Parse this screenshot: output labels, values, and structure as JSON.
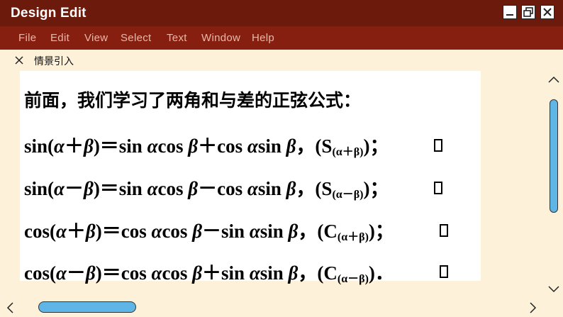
{
  "window": {
    "title": "Design Edit"
  },
  "menu": [
    {
      "label": "File"
    },
    {
      "label": "Edit"
    },
    {
      "label": "View"
    },
    {
      "label": "Select"
    },
    {
      "label": "Text"
    },
    {
      "label": "Window"
    },
    {
      "label": "Help"
    }
  ],
  "tab": {
    "label": "情景引入"
  },
  "content": {
    "heading": "前面，我们学习了两角和与差的正弦公式：",
    "formulas": [
      {
        "p1": "sin(",
        "p2": "α",
        "p3": "＋",
        "p4": "β",
        "p5": ")＝sin ",
        "p6": "α",
        "p7": "cos ",
        "p8": "β",
        "p9": "＋cos ",
        "p10": "α",
        "p11": "sin ",
        "p12": "β",
        "p13": "，(S",
        "sub": "(α＋β)",
        "p14": ")；"
      },
      {
        "p1": "sin(",
        "p2": "α",
        "p3": "－",
        "p4": "β",
        "p5": ")＝sin ",
        "p6": "α",
        "p7": "cos ",
        "p8": "β",
        "p9": "－cos ",
        "p10": "α",
        "p11": "sin ",
        "p12": "β",
        "p13": "，(S",
        "sub": "(α－β)",
        "p14": ")；"
      },
      {
        "p1": "cos(",
        "p2": "α",
        "p3": "＋",
        "p4": "β",
        "p5": ")＝cos ",
        "p6": "α",
        "p7": "cos ",
        "p8": "β",
        "p9": "－sin ",
        "p10": "α",
        "p11": "sin ",
        "p12": "β",
        "p13": "，(C",
        "sub": "(α＋β)",
        "p14": ")；"
      },
      {
        "p1": "cos(",
        "p2": "α",
        "p3": "－",
        "p4": "β",
        "p5": ")＝cos ",
        "p6": "α",
        "p7": "cos ",
        "p8": "β",
        "p9": "＋sin ",
        "p10": "α",
        "p11": "sin ",
        "p12": "β",
        "p13": "，(C",
        "sub": "(α－β)",
        "p14": ")．"
      }
    ]
  },
  "icons": {
    "minimize": "minimize-icon",
    "maximize": "maximize-icon",
    "close": "close-icon",
    "tab_close": "tab-close-icon"
  }
}
